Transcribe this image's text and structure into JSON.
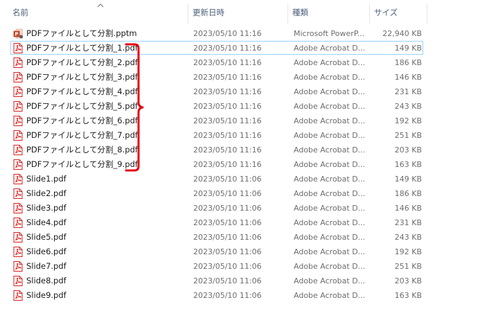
{
  "header": {
    "col_name": "名前",
    "col_date": "更新日時",
    "col_type": "種類",
    "col_size": "サイズ"
  },
  "files": [
    {
      "name": "PDFファイルとして分割.pptm",
      "date": "2023/05/10 11:16",
      "type": "Microsoft PowerP...",
      "size": "22,940 KB",
      "icon": "powerpoint-icon",
      "selected": false
    },
    {
      "name": "PDFファイルとして分割_1.pdf",
      "date": "2023/05/10 11:16",
      "type": "Adobe Acrobat D...",
      "size": "149 KB",
      "icon": "pdf-icon",
      "selected": true
    },
    {
      "name": "PDFファイルとして分割_2.pdf",
      "date": "2023/05/10 11:16",
      "type": "Adobe Acrobat D...",
      "size": "186 KB",
      "icon": "pdf-icon",
      "selected": false
    },
    {
      "name": "PDFファイルとして分割_3.pdf",
      "date": "2023/05/10 11:16",
      "type": "Adobe Acrobat D...",
      "size": "146 KB",
      "icon": "pdf-icon",
      "selected": false
    },
    {
      "name": "PDFファイルとして分割_4.pdf",
      "date": "2023/05/10 11:16",
      "type": "Adobe Acrobat D...",
      "size": "231 KB",
      "icon": "pdf-icon",
      "selected": false
    },
    {
      "name": "PDFファイルとして分割_5.pdf",
      "date": "2023/05/10 11:16",
      "type": "Adobe Acrobat D...",
      "size": "243 KB",
      "icon": "pdf-icon",
      "selected": false
    },
    {
      "name": "PDFファイルとして分割_6.pdf",
      "date": "2023/05/10 11:16",
      "type": "Adobe Acrobat D...",
      "size": "192 KB",
      "icon": "pdf-icon",
      "selected": false
    },
    {
      "name": "PDFファイルとして分割_7.pdf",
      "date": "2023/05/10 11:16",
      "type": "Adobe Acrobat D...",
      "size": "251 KB",
      "icon": "pdf-icon",
      "selected": false
    },
    {
      "name": "PDFファイルとして分割_8.pdf",
      "date": "2023/05/10 11:16",
      "type": "Adobe Acrobat D...",
      "size": "203 KB",
      "icon": "pdf-icon",
      "selected": false
    },
    {
      "name": "PDFファイルとして分割_9.pdf",
      "date": "2023/05/10 11:16",
      "type": "Adobe Acrobat D...",
      "size": "163 KB",
      "icon": "pdf-icon",
      "selected": false
    },
    {
      "name": "Slide1.pdf",
      "date": "2023/05/10 11:06",
      "type": "Adobe Acrobat D...",
      "size": "149 KB",
      "icon": "pdf-icon",
      "selected": false
    },
    {
      "name": "Slide2.pdf",
      "date": "2023/05/10 11:06",
      "type": "Adobe Acrobat D...",
      "size": "186 KB",
      "icon": "pdf-icon",
      "selected": false
    },
    {
      "name": "Slide3.pdf",
      "date": "2023/05/10 11:06",
      "type": "Adobe Acrobat D...",
      "size": "146 KB",
      "icon": "pdf-icon",
      "selected": false
    },
    {
      "name": "Slide4.pdf",
      "date": "2023/05/10 11:06",
      "type": "Adobe Acrobat D...",
      "size": "231 KB",
      "icon": "pdf-icon",
      "selected": false
    },
    {
      "name": "Slide5.pdf",
      "date": "2023/05/10 11:06",
      "type": "Adobe Acrobat D...",
      "size": "243 KB",
      "icon": "pdf-icon",
      "selected": false
    },
    {
      "name": "Slide6.pdf",
      "date": "2023/05/10 11:06",
      "type": "Adobe Acrobat D...",
      "size": "192 KB",
      "icon": "pdf-icon",
      "selected": false
    },
    {
      "name": "Slide7.pdf",
      "date": "2023/05/10 11:06",
      "type": "Adobe Acrobat D...",
      "size": "251 KB",
      "icon": "pdf-icon",
      "selected": false
    },
    {
      "name": "Slide8.pdf",
      "date": "2023/05/10 11:06",
      "type": "Adobe Acrobat D...",
      "size": "203 KB",
      "icon": "pdf-icon",
      "selected": false
    },
    {
      "name": "Slide9.pdf",
      "date": "2023/05/10 11:06",
      "type": "Adobe Acrobat D...",
      "size": "163 KB",
      "icon": "pdf-icon",
      "selected": false
    }
  ],
  "colors": {
    "pdf_red": "#d61e1e",
    "ppt_orange": "#c4482a",
    "selection_border": "#99d1ff",
    "annotation_brace": "#e60012"
  }
}
